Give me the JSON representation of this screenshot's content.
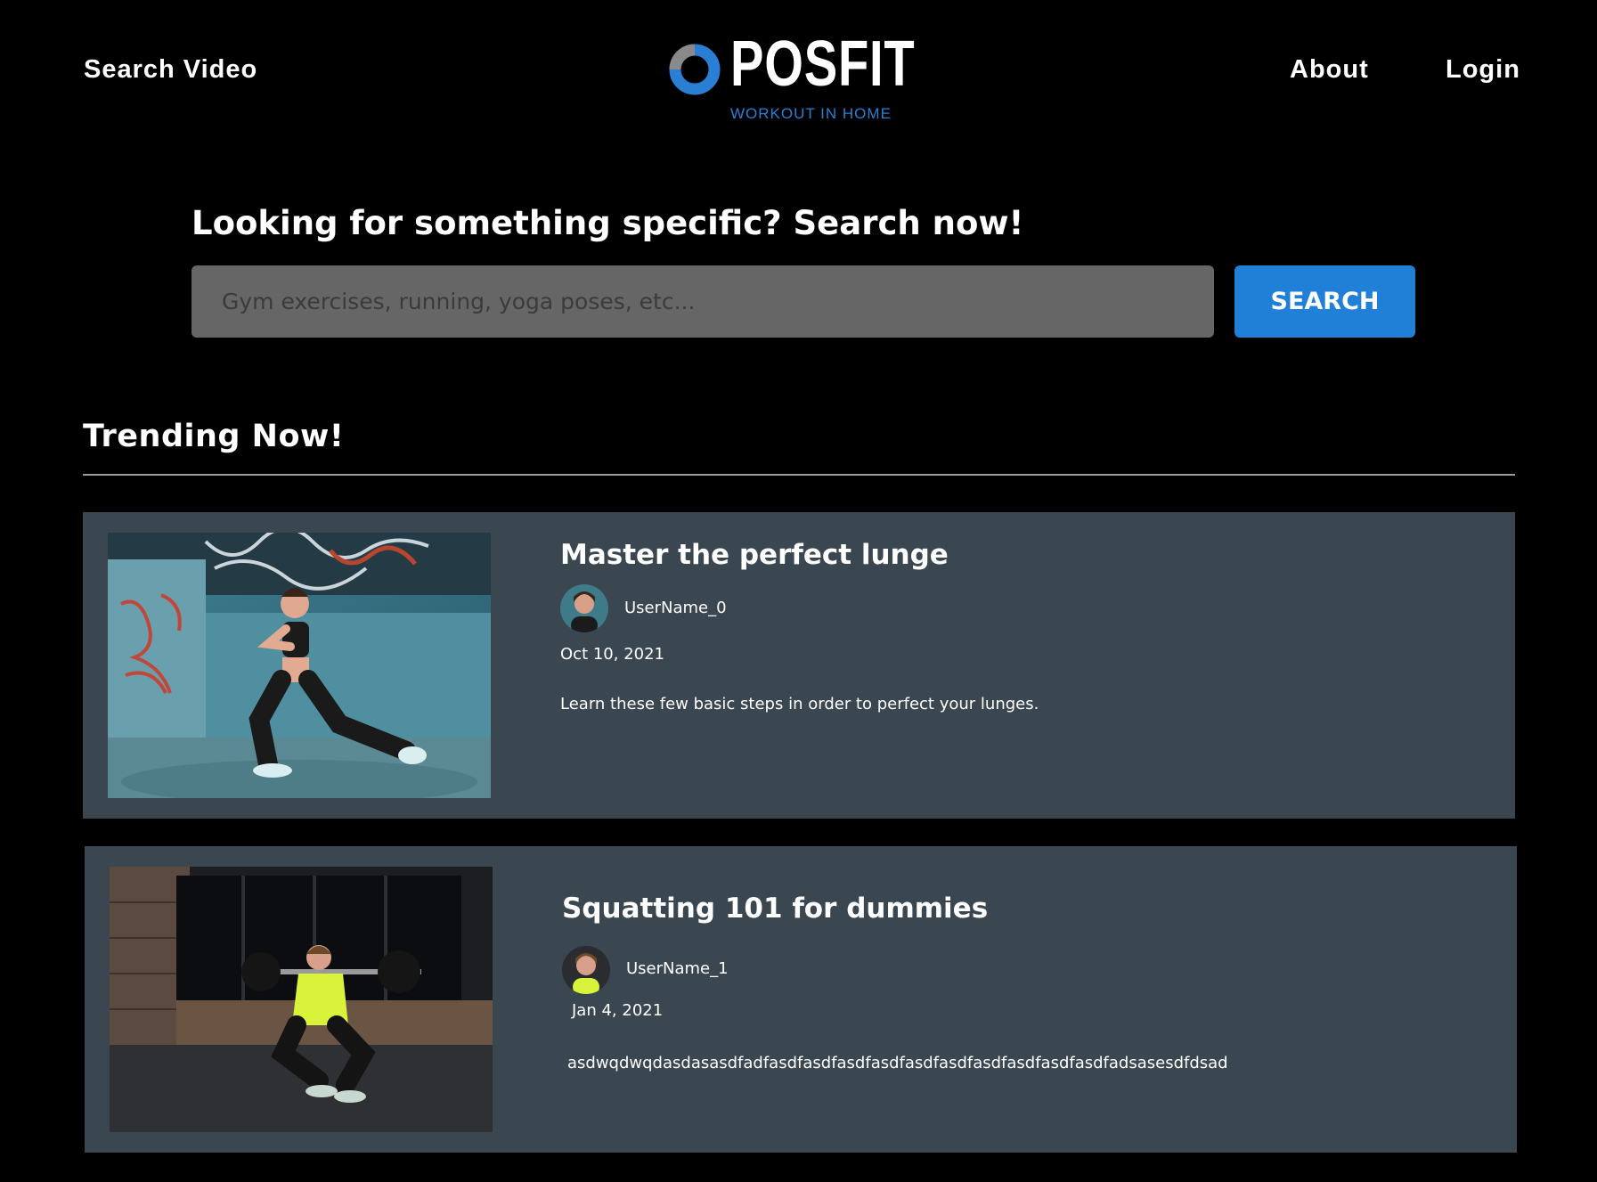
{
  "header": {
    "search_video_label": "Search Video",
    "about_label": "About",
    "login_label": "Login",
    "logo_text": "POSFIT",
    "logo_tagline": "WORKOUT IN HOME"
  },
  "search": {
    "heading": "Looking for something specific? Search now!",
    "placeholder": "Gym exercises, running, yoga poses, etc...",
    "button_label": "SEARCH"
  },
  "trending": {
    "title": "Trending Now!",
    "videos": [
      {
        "title": "Master the perfect lunge",
        "username": "UserName_0",
        "date": "Oct 10, 2021",
        "description": "Learn these few basic steps in order to perfect your lunges."
      },
      {
        "title": "Squatting 101 for dummies",
        "username": "UserName_1",
        "date": "Jan 4, 2021",
        "description": "asdwqdwqdasdasasdfadfasdfasdfasdfasdfasdfasdfasdfasdfasdfasdfadsasesdfdsad"
      }
    ]
  },
  "colors": {
    "background": "#000000",
    "accent": "#2080d8",
    "card_background": "#3a4650",
    "input_background": "#666666"
  }
}
